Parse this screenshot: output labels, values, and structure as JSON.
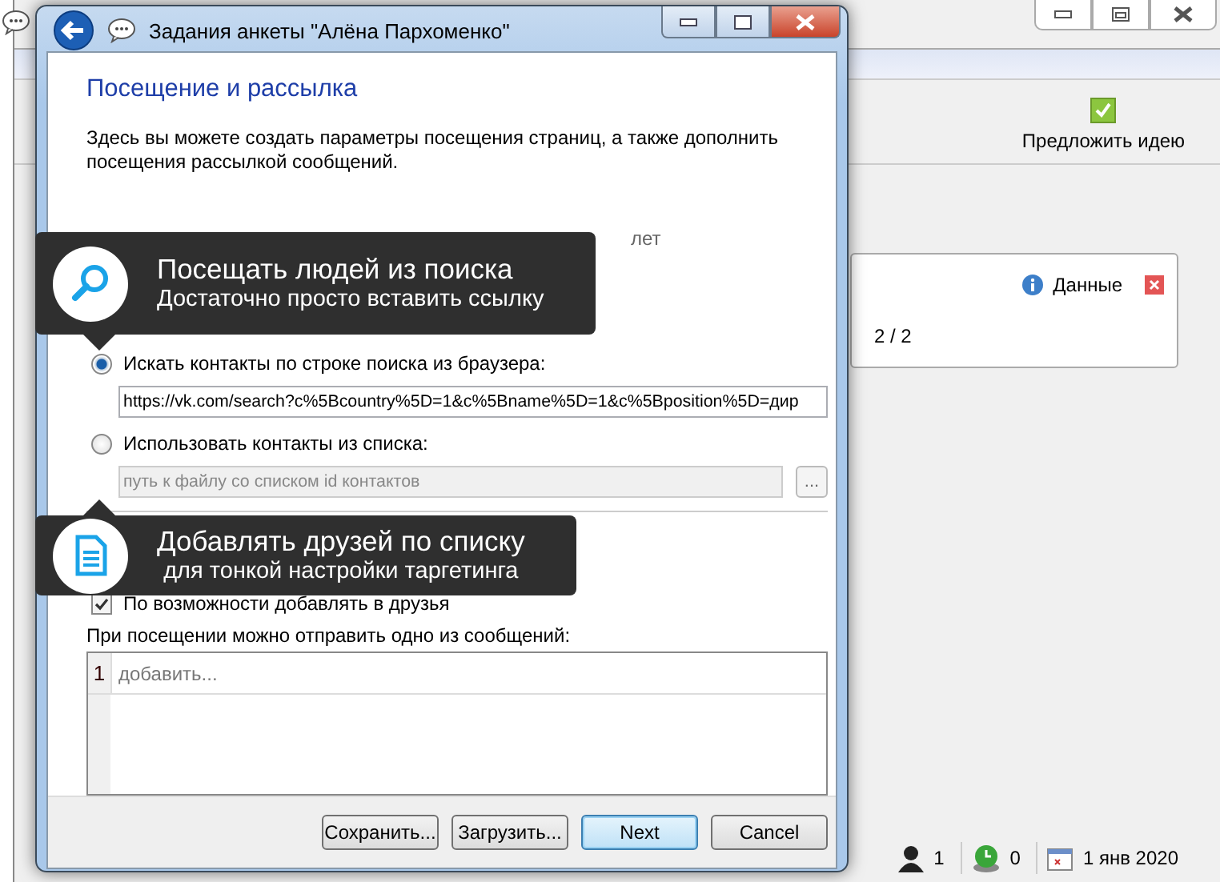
{
  "main_window": {
    "toolbar": [
      {
        "label": "Предложить идею"
      }
    ],
    "card": {
      "info_label": "Данные",
      "text": "2 / 2"
    },
    "status_bar": {
      "users": "1",
      "online": "0",
      "date": "1 янв 2020"
    }
  },
  "dialog": {
    "title": "Задания анкеты \"Алёна Пархоменко\"",
    "heading": "Посещение и рассылка",
    "description": "Здесь вы можете создать параметры посещения страниц, а также дополнить посещения рассылкой сообщений.",
    "age_unit": "лет",
    "options": [
      {
        "kind": "radio",
        "label": "Искать контакты по строке поиска из браузера:",
        "selected": true
      },
      {
        "kind": "field",
        "value": "https://vk.com/search?c%5Bcountry%5D=1&c%5Bname%5D=1&c%5Bposition%5D=дир",
        "disabled": false
      },
      {
        "kind": "radio",
        "label": "Использовать контакты из списка:",
        "selected": false
      },
      {
        "kind": "file",
        "placeholder": "путь к файлу со списком id контактов",
        "button": "...",
        "disabled": true
      },
      {
        "kind": "rule"
      },
      {
        "kind": "gap"
      },
      {
        "kind": "checkbox",
        "label": "По возможности добавлять в друзья",
        "checked": true,
        "disabled": false
      }
    ],
    "messages_label": "При посещении можно отправить одно из сообщений:",
    "messages": [
      {
        "number": "1",
        "placeholder": "добавить..."
      }
    ],
    "buttons": [
      {
        "label": "Сохранить...",
        "default": false
      },
      {
        "label": "Загрузить...",
        "default": false
      },
      {
        "label": "Next",
        "default": true
      },
      {
        "label": "Cancel",
        "default": false
      }
    ]
  },
  "tooltips": [
    {
      "kind": "search",
      "title": "Посещать людей из поиска",
      "subtitle": "Достаточно просто вставить ссылку"
    },
    {
      "kind": "document",
      "title": "Добавлять друзей по списку",
      "subtitle": "для тонкой настройки таргетинга"
    }
  ]
}
